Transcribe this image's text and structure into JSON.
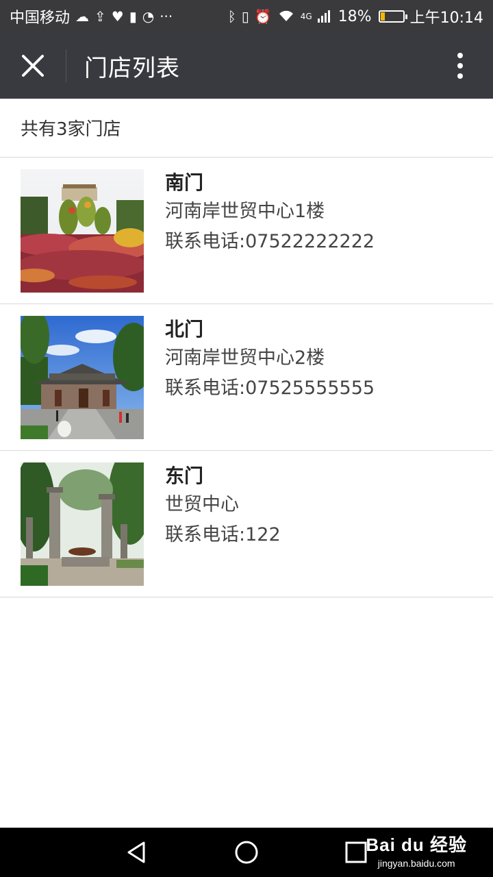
{
  "status_bar": {
    "carrier": "中国移动",
    "network": "4G",
    "battery": "18%",
    "battery_level": 0.18,
    "time": "上午10:14"
  },
  "header": {
    "title": "门店列表"
  },
  "summary": {
    "text": "共有3家门店"
  },
  "stores": [
    {
      "name": "南门",
      "address": "河南岸世贸中心1楼",
      "phone": "联系电话:07522222222"
    },
    {
      "name": "北门",
      "address": "河南岸世贸中心2楼",
      "phone": "联系电话:07525555555"
    },
    {
      "name": "东门",
      "address": "世贸中心",
      "phone": "联系电话:122"
    }
  ],
  "watermark": {
    "brand": "Bai du 经验",
    "url": "jingyan.baidu.com"
  },
  "colors": {
    "titlebar": "#393a3f",
    "statusbar": "#3a3a3c",
    "divider": "#d8d8d8",
    "battery": "#f5b800"
  }
}
